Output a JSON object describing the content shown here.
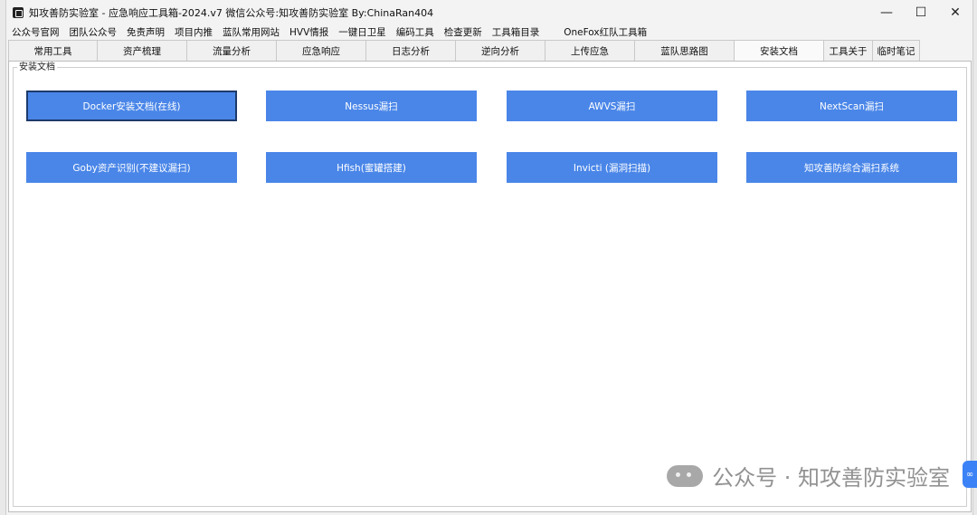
{
  "window": {
    "title": "知攻善防实验室 - 应急响应工具箱-2024.v7    微信公众号:知攻善防实验室   By:ChinaRan404",
    "controls": {
      "minimize": "—",
      "maximize": "☐",
      "close": "✕"
    }
  },
  "menu": [
    "公众号官网",
    "团队公众号",
    "免责声明",
    "项目内推",
    "蓝队常用网站",
    "HVV情报",
    "一键日卫星",
    "编码工具",
    "检查更新",
    "工具箱目录",
    "OneFox红队工具箱"
  ],
  "tabs": [
    "常用工具",
    "资产梳理",
    "流量分析",
    "应急响应",
    "日志分析",
    "逆向分析",
    "上传应急",
    "蓝队思路图",
    "安装文档",
    "工具关于",
    "临时笔记"
  ],
  "group_label": "安装文档",
  "buttons": [
    "Docker安装文档(在线)",
    "Nessus漏扫",
    "AWVS漏扫",
    "NextScan漏扫",
    "Goby资产识别(不建议漏扫)",
    "Hfish(蜜罐搭建)",
    "Invicti (漏洞扫描)",
    "知攻善防综合漏扫系统"
  ],
  "watermark": "公众号 · 知攻善防实验室",
  "colors": {
    "button": "#4a86e8",
    "button_text": "#ffffff",
    "focus_border": "#1e3a6b"
  }
}
